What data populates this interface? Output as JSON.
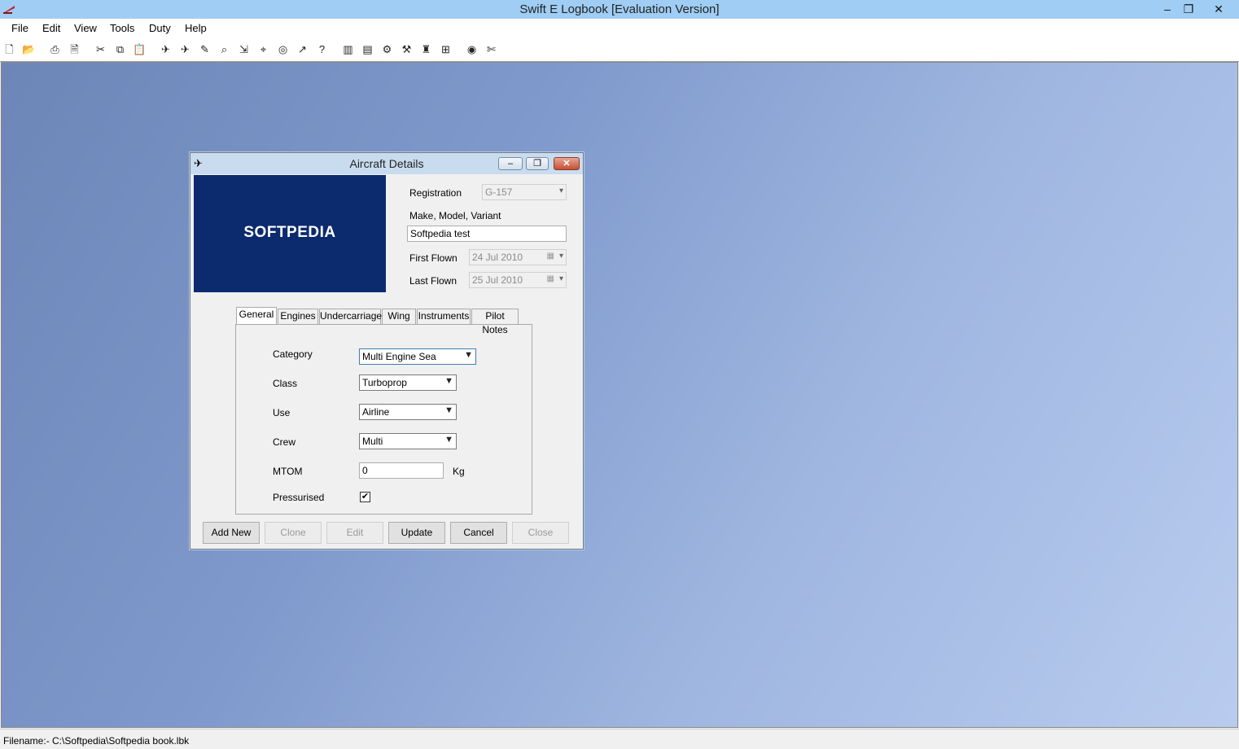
{
  "window": {
    "title": "Swift E Logbook [Evaluation Version]",
    "controls": {
      "minimize": "–",
      "restore": "❐",
      "close": "✕"
    }
  },
  "menu": [
    "File",
    "Edit",
    "View",
    "Tools",
    "Duty",
    "Help"
  ],
  "toolbar_icons": [
    "new-icon",
    "open-icon",
    "print-icon",
    "print-preview-icon",
    "cut-icon",
    "copy-icon",
    "paste-icon",
    "aircraft-icon",
    "airplane-icon",
    "edit-flight-icon",
    "search-icon",
    "landing-icon",
    "navigation-icon",
    "radio-icon",
    "takeoff-icon",
    "help-icon",
    "chart-icon",
    "book-icon",
    "settings-icon",
    "tools-icon",
    "certificate-icon",
    "duty-icon",
    "globe-icon",
    "scissors-icon"
  ],
  "dialog": {
    "title": "Aircraft Details",
    "logo": "SOFTPEDIA",
    "registration_label": "Registration",
    "registration_value": "G-157",
    "make_label": "Make, Model, Variant",
    "make_value": "Softpedia test",
    "first_flown_label": "First Flown",
    "first_flown_value": "24  Jul  2010",
    "last_flown_label": "Last Flown",
    "last_flown_value": "25  Jul  2010",
    "tabs": [
      "General",
      "Engines",
      "Undercarriage",
      "Wing",
      "Instruments",
      "Pilot Notes"
    ],
    "general": {
      "category_label": "Category",
      "category_value": "Multi Engine Sea",
      "class_label": "Class",
      "class_value": "Turboprop",
      "use_label": "Use",
      "use_value": "Airline",
      "crew_label": "Crew",
      "crew_value": "Multi",
      "mtom_label": "MTOM",
      "mtom_value": "0",
      "mtom_unit": "Kg",
      "pressurised_label": "Pressurised",
      "pressurised_checked": true
    },
    "buttons": {
      "add_new": "Add New",
      "clone": "Clone",
      "edit": "Edit",
      "update": "Update",
      "cancel": "Cancel",
      "close": "Close"
    }
  },
  "status": {
    "filename": "Filename:- C:\\Softpedia\\Softpedia book.lbk"
  }
}
